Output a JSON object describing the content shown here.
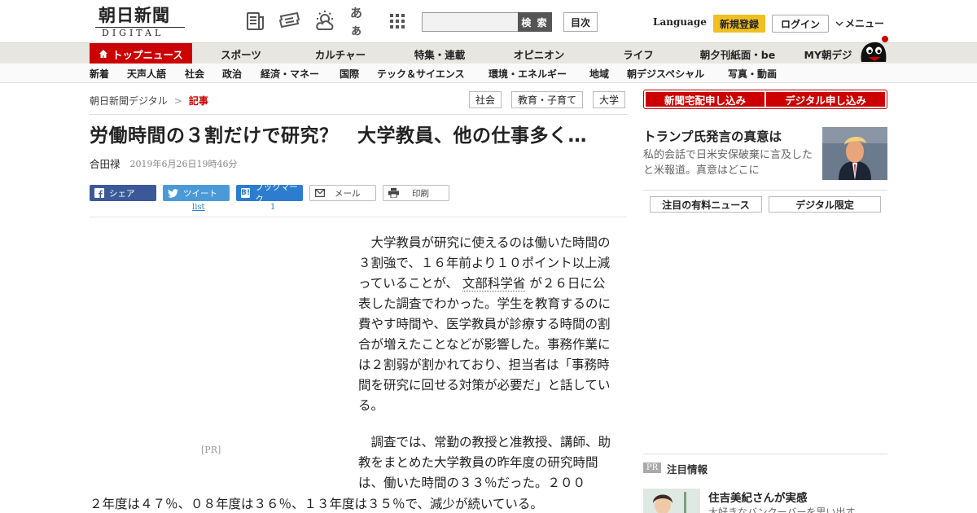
{
  "header": {
    "logo_main": "朝日新聞",
    "logo_sub": "DIGITAL",
    "icons": [
      "newspaper-icon",
      "coupon-icon",
      "weather-icon",
      "font-size-icon",
      "apps-grid-icon"
    ],
    "font_icon_text": "あぁ",
    "search_placeholder": "",
    "search_button": "検 索",
    "toc_button": "目次",
    "language": "Language",
    "register": "新規登録",
    "login": "ログイン",
    "menu": "メニュー"
  },
  "mainnav": [
    "トップニュース",
    "スポーツ",
    "カルチャー",
    "特集・連載",
    "オピニオン",
    "ライフ",
    "朝夕刊紙面・be",
    "MY朝デジ"
  ],
  "subnav": [
    "新着",
    "天声人語",
    "社会",
    "政治",
    "経済・マネー",
    "国際",
    "テック＆サイエンス",
    "環境・エネルギー",
    "地域",
    "朝デジスペシャル",
    "写真・動画"
  ],
  "breadcrumb": {
    "home": "朝日新聞デジタル",
    "separator": ">",
    "current": "記事"
  },
  "tags": [
    "社会",
    "教育・子育て",
    "大学"
  ],
  "article": {
    "title": "労働時間の３割だけで研究？　大学教員、他の仕事多く…",
    "author": "合田禄",
    "date": "2019年6月26日19時46分",
    "share": {
      "facebook": "シェア",
      "twitter": "ツイート",
      "twitter_count": "list",
      "hatena": "ブックマーク",
      "hatena_count": "1",
      "mail": "メール",
      "print": "印刷"
    },
    "pr_label": "[PR]",
    "p1_a": "大学教員が研究に使えるのは働いた時間の３割強で、１６年前より１０ポイント以上減っていることが、",
    "p1_keyword": "文部科学省",
    "p1_b": "が２６日に公表した調査でわかった。学生を教育するのに費やす時間や、医学教員が診療する時間の割合が増えたことなどが影響した。事務作業には２割弱が割かれており、担当者は「事務時間を研究に回せる対策が必要だ」と話している。",
    "p2": "調査では、常勤の教授と准教授、講師、助教をまとめた大学教員の昨年度の研究時間は、働いた時間の３３％だった。２００",
    "p2_cont": "２年度は４７％、０８年度は３６％、１３年度は３５％で、減少が続いている。"
  },
  "sidebar": {
    "subscribe_paper": "新聞宅配申し込み",
    "subscribe_digital": "デジタル申し込み",
    "feature_title": "トランプ氏発言の真意は",
    "feature_desc": "私的会話で日米安保破棄に言及したと米報道。真意はどこに",
    "tab_paid": "注目の有料ニュース",
    "tab_digital": "デジタル限定",
    "pr_badge": "PR",
    "attention_label": "注目情報",
    "attention_title": "住吉美紀さんが実感",
    "attention_desc": "大好きなバンクーバーを思い出す"
  },
  "colors": {
    "brand_red": "#cc0000",
    "register_yellow": "#f0c020",
    "facebook": "#3b5998",
    "twitter": "#4a9ad8",
    "hatena": "#2c7dd0"
  }
}
